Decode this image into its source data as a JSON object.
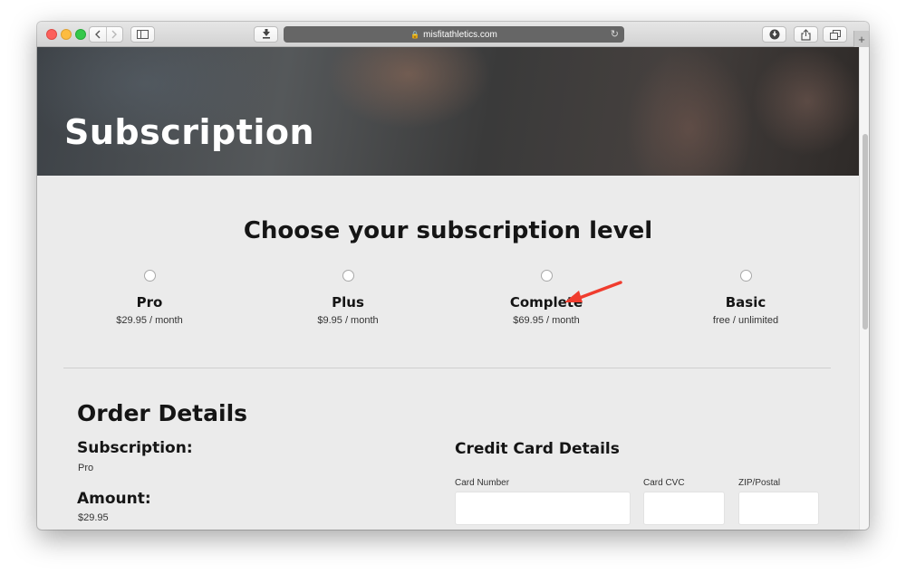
{
  "browser": {
    "url": "misfitathletics.com",
    "lock_icon": "lock-icon",
    "reload_icon": "reload-icon",
    "new_tab_label": "+"
  },
  "hero": {
    "title": "Subscription"
  },
  "choose": {
    "heading": "Choose your subscription level",
    "plans": [
      {
        "name": "Pro",
        "price": "$29.95 / month"
      },
      {
        "name": "Plus",
        "price": "$9.95 / month"
      },
      {
        "name": "Complete",
        "price": "$69.95 / month"
      },
      {
        "name": "Basic",
        "price": "free / unlimited"
      }
    ],
    "annotation_color": "#f03c2e"
  },
  "order": {
    "heading": "Order Details",
    "subscription_label": "Subscription:",
    "subscription_value": "Pro",
    "amount_label": "Amount:",
    "amount_value": "$29.95"
  },
  "credit_card": {
    "heading": "Credit Card Details",
    "card_number_label": "Card Number",
    "card_cvc_label": "Card CVC",
    "zip_label": "ZIP/Postal",
    "card_number_value": "",
    "card_cvc_value": "",
    "zip_value": ""
  }
}
